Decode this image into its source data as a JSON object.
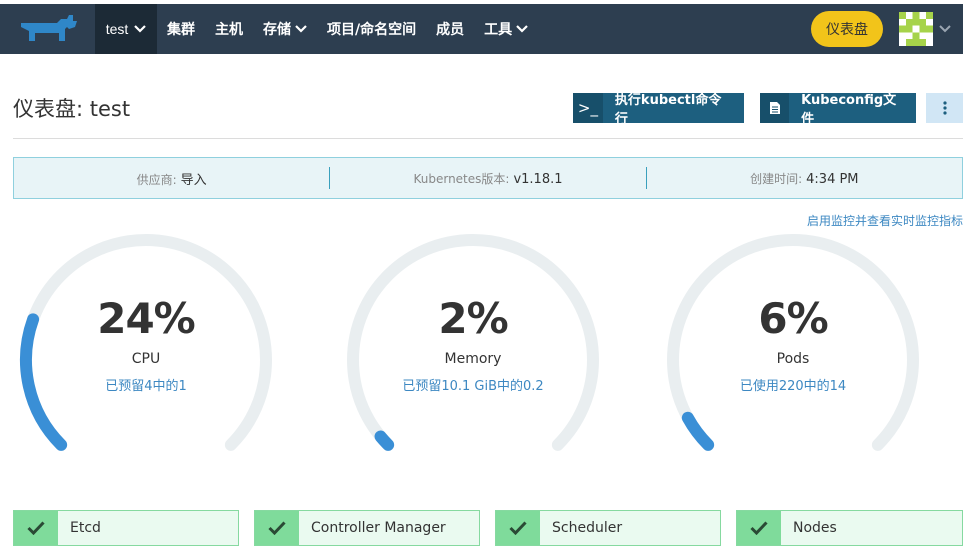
{
  "nav": {
    "cluster": "test",
    "items": [
      {
        "label": "集群",
        "has_dropdown": false
      },
      {
        "label": "主机",
        "has_dropdown": false
      },
      {
        "label": "存储",
        "has_dropdown": true
      },
      {
        "label": "项目/命名空间",
        "has_dropdown": false
      },
      {
        "label": "成员",
        "has_dropdown": false
      },
      {
        "label": "工具",
        "has_dropdown": true
      }
    ],
    "dashboard_pill": "仪表盘"
  },
  "page": {
    "title": "仪表盘: test",
    "kubectl_label": "执行kubectl命令行",
    "kubectl_icon": ">_",
    "kubeconfig_label": "Kubeconfig文件"
  },
  "info": {
    "provider_key": "供应商:",
    "provider_val": "导入",
    "k8s_key": "Kubernetes版本:",
    "k8s_val": "v1.18.1",
    "created_key": "创建时间:",
    "created_val": "4:34 PM"
  },
  "monitor_link": "启用监控并查看实时监控指标",
  "gauges": [
    {
      "pct": "24%",
      "name": "CPU",
      "sub": "已预留4中的1",
      "fraction": 0.24
    },
    {
      "pct": "2%",
      "name": "Memory",
      "sub": "已预留10.1 GiB中的0.2",
      "fraction": 0.02
    },
    {
      "pct": "6%",
      "name": "Pods",
      "sub": "已使用220中的14",
      "fraction": 0.06
    }
  ],
  "statuses": [
    {
      "label": "Etcd"
    },
    {
      "label": "Controller Manager"
    },
    {
      "label": "Scheduler"
    },
    {
      "label": "Nodes"
    }
  ],
  "colors": {
    "navbar": "#2d3e50",
    "accent_blue": "#3d88c2",
    "gauge_track": "#e9eef0",
    "gauge_fill": "#3a8fd6",
    "pill_yellow": "#f2c41a",
    "status_green": "#7fdb9b"
  }
}
